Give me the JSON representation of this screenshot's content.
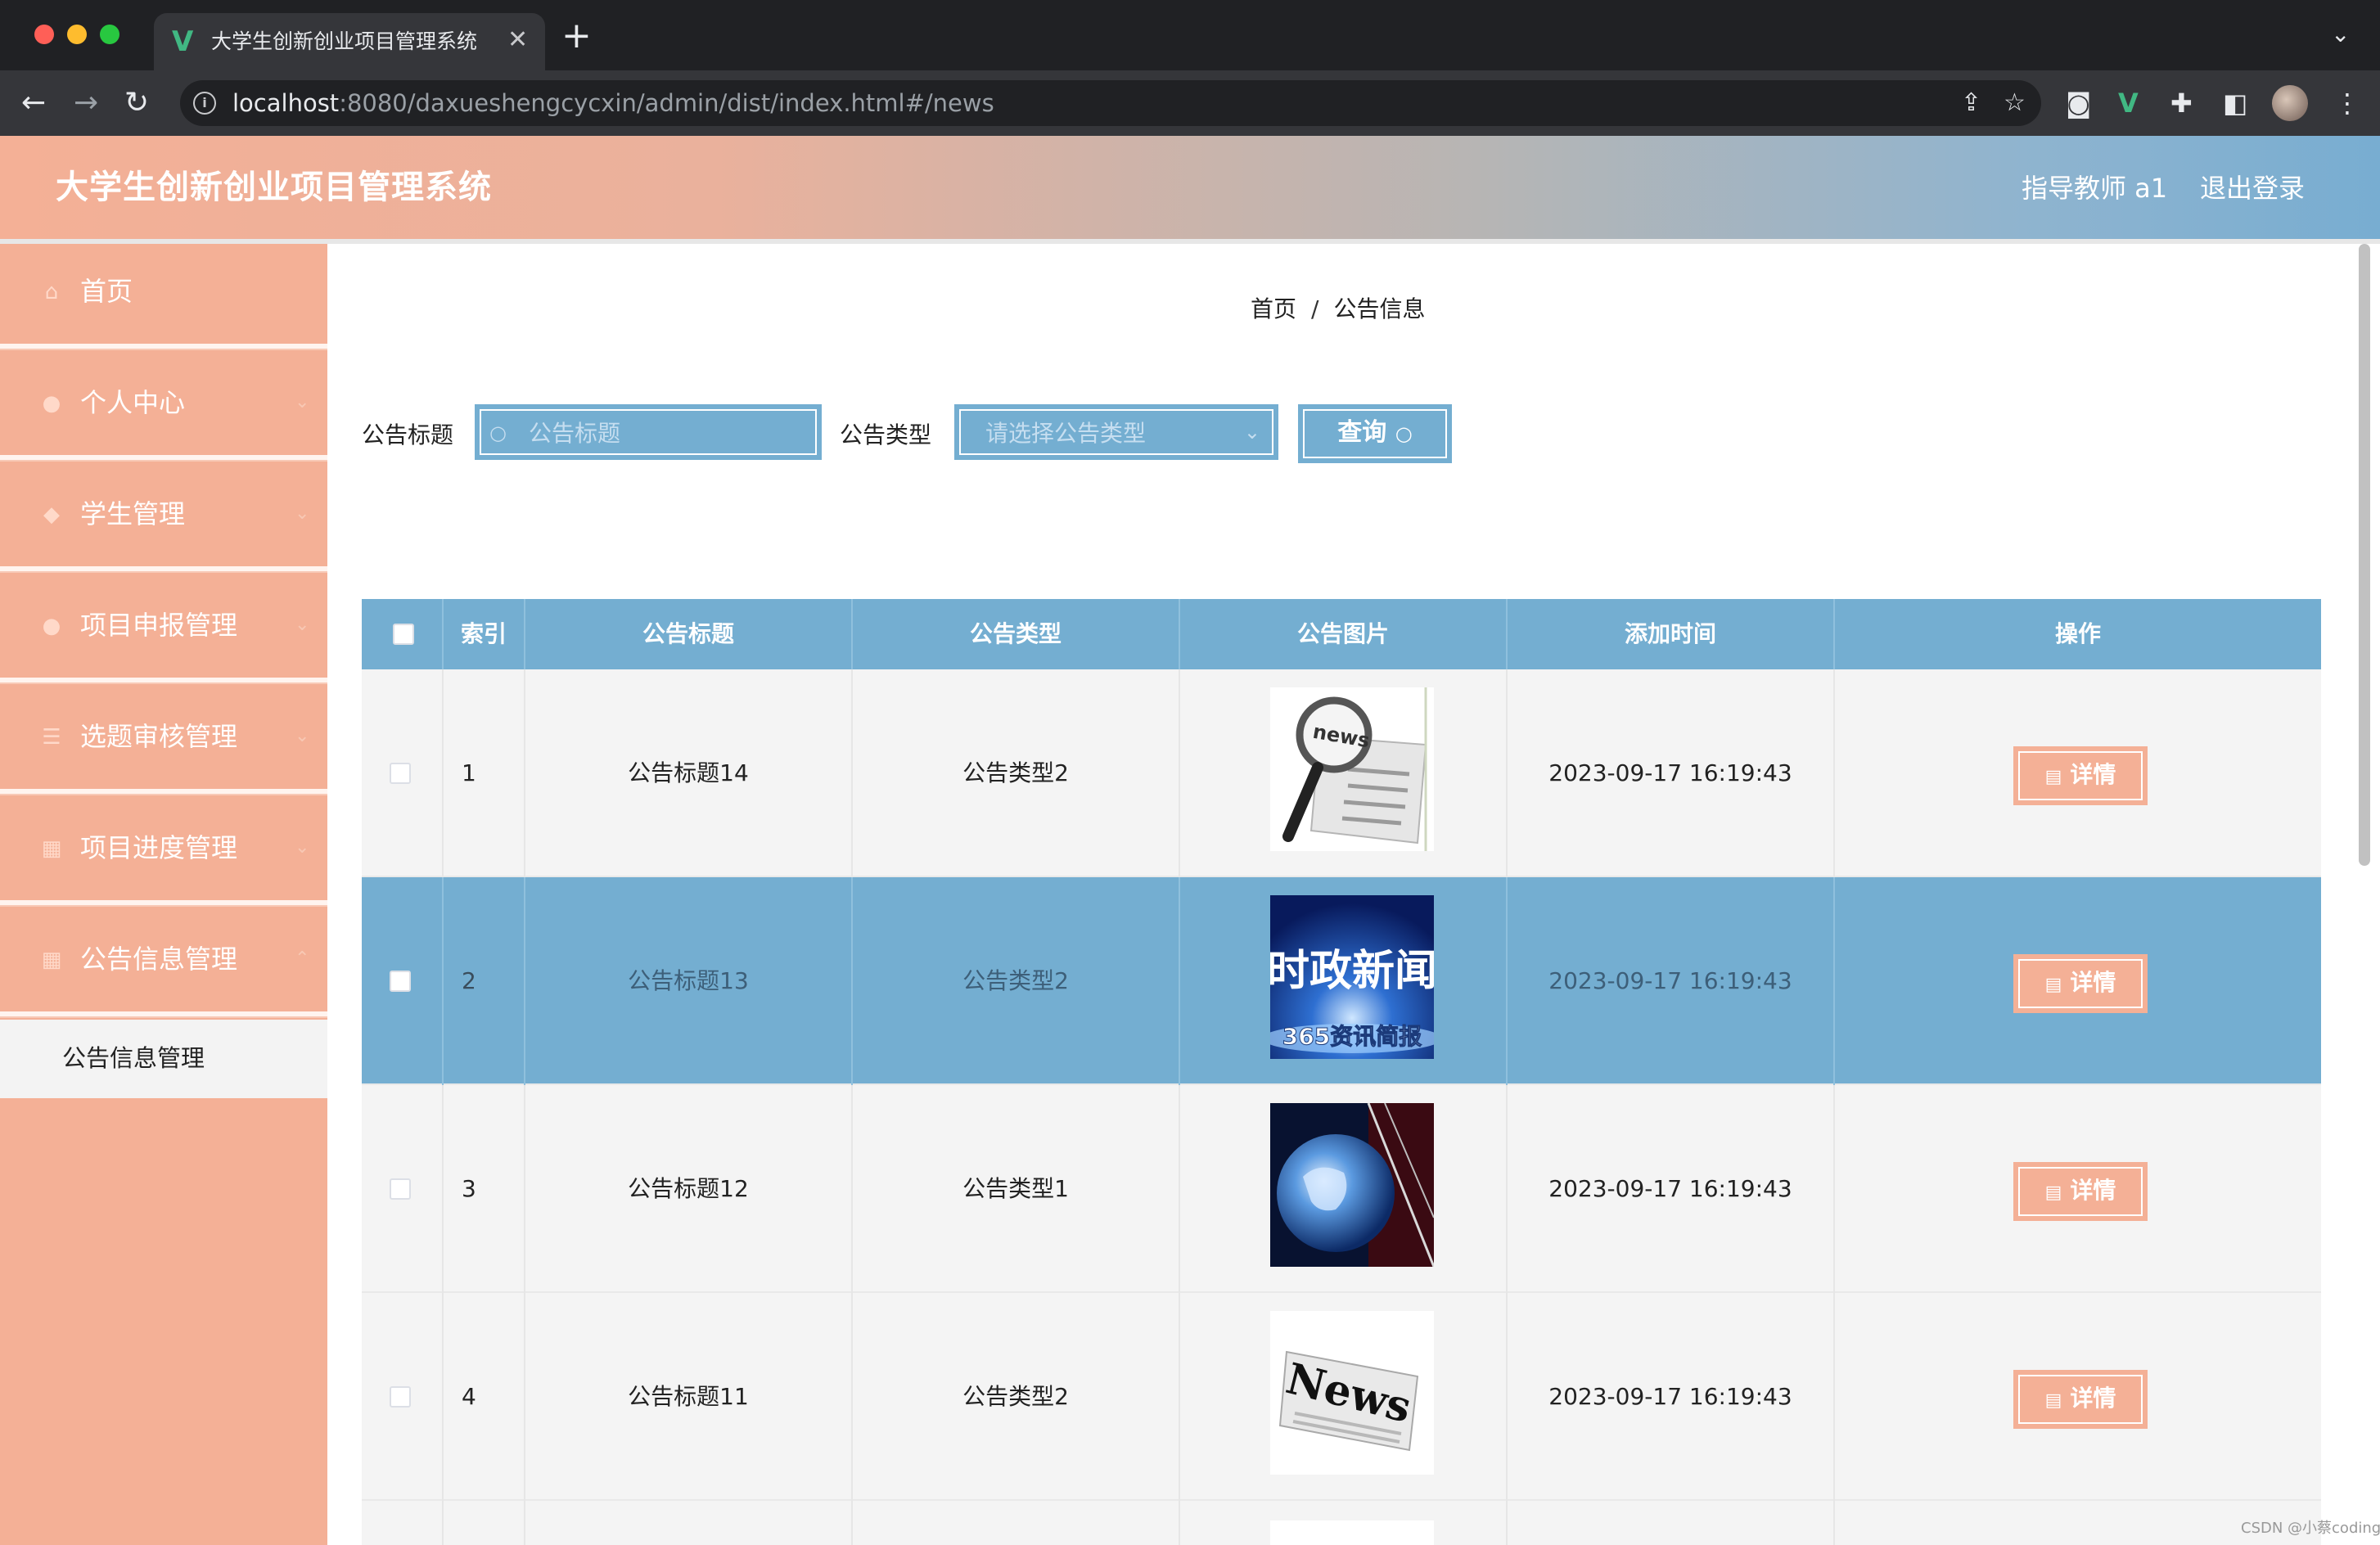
{
  "browser": {
    "tab_title": "大学生创新创业项目管理系统",
    "url_host": "localhost",
    "url_rest": ":8080/daxueshengcycxin/admin/dist/index.html#/news"
  },
  "header": {
    "title": "大学生创新创业项目管理系统",
    "user": "指导教师 a1",
    "logout": "退出登录"
  },
  "sidebar": {
    "items": [
      {
        "label": "首页"
      },
      {
        "label": "个人中心"
      },
      {
        "label": "学生管理"
      },
      {
        "label": "项目申报管理"
      },
      {
        "label": "选题审核管理"
      },
      {
        "label": "项目进度管理"
      },
      {
        "label": "公告信息管理"
      }
    ],
    "subitem": "公告信息管理"
  },
  "breadcrumb": {
    "home": "首页",
    "current": "公告信息"
  },
  "filters": {
    "title_label": "公告标题",
    "title_placeholder": "公告标题",
    "type_label": "公告类型",
    "type_placeholder": "请选择公告类型",
    "query_label": "查询"
  },
  "table": {
    "headers": [
      "索引",
      "公告标题",
      "公告类型",
      "公告图片",
      "添加时间",
      "操作"
    ],
    "rows": [
      {
        "index": "1",
        "title": "公告标题14",
        "type": "公告类型2",
        "image": "news-magnifier",
        "time": "2023-09-17 16:19:43",
        "action": "详情"
      },
      {
        "index": "2",
        "title": "公告标题13",
        "type": "公告类型2",
        "image": "news-blue-banner",
        "image_text_1": "时政新闻",
        "image_text_2": "365资讯简报",
        "time": "2023-09-17 16:19:43",
        "action": "详情"
      },
      {
        "index": "3",
        "title": "公告标题12",
        "type": "公告类型1",
        "image": "news-globe",
        "time": "2023-09-17 16:19:43",
        "action": "详情"
      },
      {
        "index": "4",
        "title": "公告标题11",
        "type": "公告类型2",
        "image": "news-newspaper",
        "image_text_1": "News",
        "time": "2023-09-17 16:19:43",
        "action": "详情"
      }
    ]
  },
  "watermark": "CSDN @小蔡coding",
  "colors": {
    "accent_blue": "#74aed1",
    "accent_peach": "#f4b096"
  }
}
